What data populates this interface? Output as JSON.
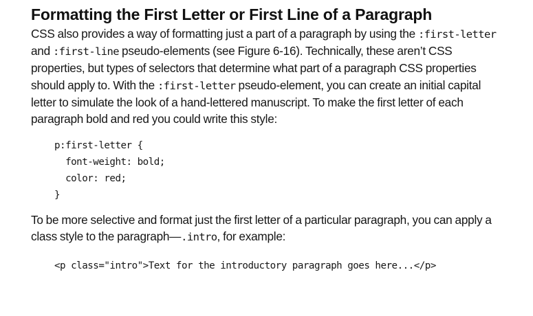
{
  "heading": "Formatting the First Letter or First Line of a Paragraph",
  "paragraph1": {
    "t1": "CSS also provides a way of formatting just a part of a paragraph by using the ",
    "c1": ":first-letter",
    "t2": " and ",
    "c2": ":first-line",
    "t3": " pseudo-elements (see Figure 6-16). Technically, these aren’t CSS properties, but types of selectors that determine what part of a paragraph CSS properties should apply to. With the ",
    "c3": ":first-letter",
    "t4": " pseudo-element, you can create an initial capital letter to simulate the look of a hand-lettered manuscript. To make the first letter of each paragraph bold and red you could write this style:"
  },
  "code_block1": {
    "lines": [
      "p:first-letter {",
      "  font-weight: bold;",
      "  color: red;",
      "}"
    ]
  },
  "paragraph2": {
    "t1": "To be more selective and format just the first letter of a particular paragraph, you can apply a class style to the paragraph—",
    "c1": ".intro",
    "t2": ", for example:"
  },
  "code_block2": {
    "line": "<p class=\"intro\">Text for the introductory paragraph goes here...</p>"
  }
}
